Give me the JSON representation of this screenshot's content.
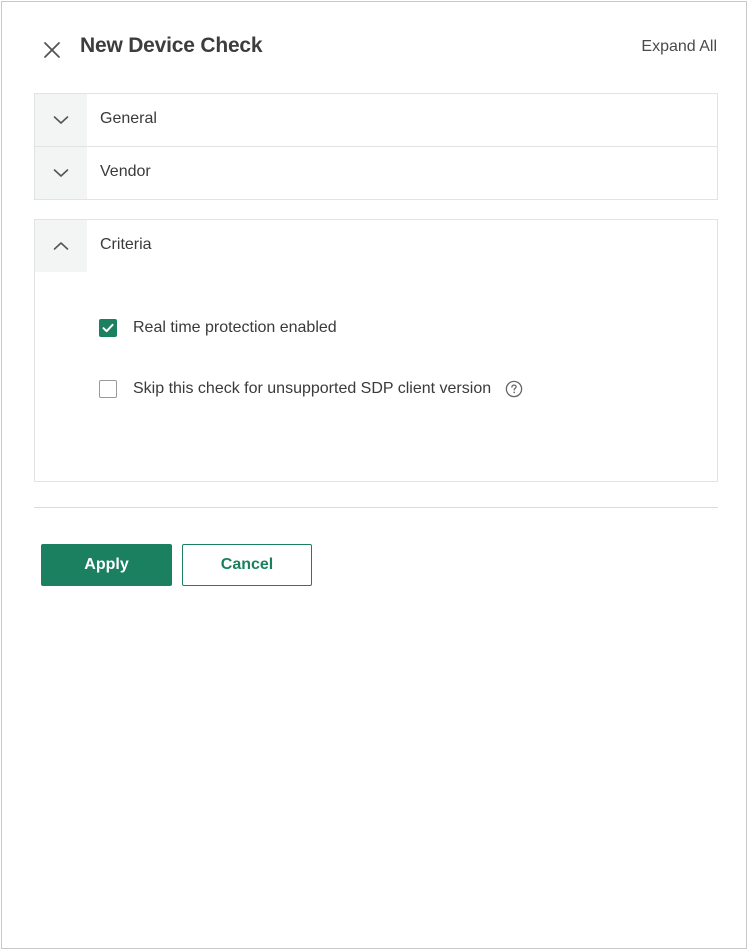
{
  "header": {
    "title": "New Device Check",
    "expand_all": "Expand All",
    "close_icon": "close-icon"
  },
  "sections": [
    {
      "label": "General",
      "expanded": false,
      "icon": "chevron-down-icon"
    },
    {
      "label": "Vendor",
      "expanded": false,
      "icon": "chevron-down-icon"
    },
    {
      "label": "Criteria",
      "expanded": true,
      "icon": "chevron-up-icon"
    }
  ],
  "criteria": {
    "options": [
      {
        "label": "Real time protection enabled",
        "checked": true
      },
      {
        "label": "Skip this check for unsupported SDP client version",
        "checked": false,
        "icon": "help-icon"
      }
    ]
  },
  "actions": {
    "apply": "Apply",
    "cancel": "Cancel"
  },
  "colors": {
    "accent": "#1b8060",
    "border": "#e3e3e3",
    "toggle_bg": "#f2f5f3"
  }
}
